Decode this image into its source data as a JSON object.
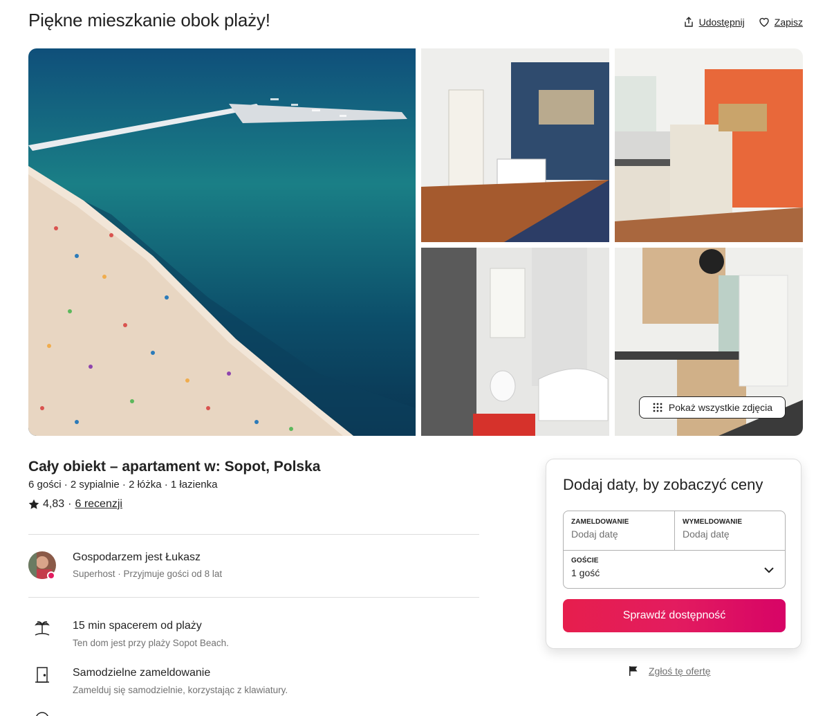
{
  "listing": {
    "title": "Piękne mieszkanie obok plaży!",
    "share_label": "Udostępnij",
    "save_label": "Zapisz",
    "show_all_photos": "Pokaż wszystkie zdjęcia",
    "subtitle": "Cały obiekt – apartament w: Sopot, Polska",
    "specs": "6 gości · 2 sypialnie · 2 łóżka · 1 łazienka",
    "rating": "4,83",
    "rating_sep": "·",
    "reviews": "6 recenzji"
  },
  "host": {
    "name": "Gospodarzem jest Łukasz",
    "subtitle": "Superhost · Przyjmuje gości od 8 lat"
  },
  "features": [
    {
      "icon": "palm-tree-icon",
      "title": "15 min spacerem od plaży",
      "subtitle": "Ten dom jest przy plaży Sopot Beach."
    },
    {
      "icon": "door-icon",
      "title": "Samodzielne zameldowanie",
      "subtitle": "Zamelduj się samodzielnie, korzystając z klawiatury."
    }
  ],
  "booking": {
    "title": "Dodaj daty, by zobaczyć ceny",
    "checkin_label": "ZAMELDOWANIE",
    "checkin_value": "Dodaj datę",
    "checkout_label": "WYMELDOWANIE",
    "checkout_value": "Dodaj datę",
    "guests_label": "GOŚCIE",
    "guests_value": "1 gość",
    "button": "Sprawdź dostępność",
    "accent": "#e31c5f"
  },
  "report": {
    "label": "Zgłoś tę ofertę"
  }
}
